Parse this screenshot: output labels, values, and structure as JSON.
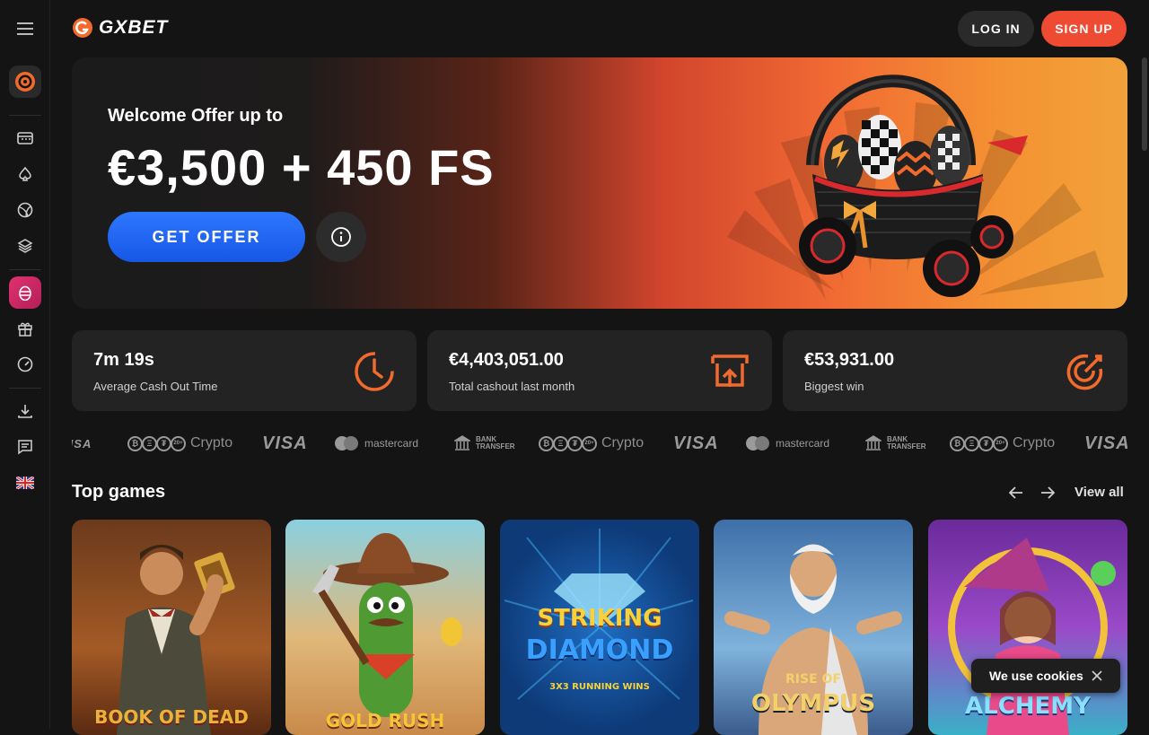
{
  "brand": {
    "name": "GXBET"
  },
  "header": {
    "login_label": "LOG IN",
    "signup_label": "SIGN UP"
  },
  "hero": {
    "subtitle": "Welcome Offer up to",
    "title": "€3,500 + 450 FS",
    "cta_label": "GET OFFER"
  },
  "stats": [
    {
      "value": "7m 19s",
      "label": "Average Cash Out Time",
      "icon": "timer-icon"
    },
    {
      "value": "€4,403,051.00",
      "label": "Total cashout last month",
      "icon": "cashout-icon"
    },
    {
      "value": "€53,931.00",
      "label": "Biggest win",
      "icon": "target-icon"
    }
  ],
  "payments": {
    "crypto_label": "Crypto",
    "visa_label": "VISA",
    "mastercard_label": "mastercard",
    "bank_line1": "BANK",
    "bank_line2": "TRANSFER",
    "coin_more": "20+"
  },
  "top_games": {
    "title": "Top games",
    "view_all_label": "View all",
    "games": [
      {
        "title_line1": "BOOK OF DEAD",
        "title_line2": ""
      },
      {
        "title_line1": "GOLD RUSH",
        "title_line2": ""
      },
      {
        "title_line1": "STRIKING",
        "title_line2": "DIAMOND",
        "tagline": "3X3 RUNNING WINS"
      },
      {
        "title_line1": "RISE OF",
        "title_line2": "OLYMPUS"
      },
      {
        "title_line1": "ALCHEMY",
        "title_line2": ""
      }
    ]
  },
  "cookie": {
    "text": "We use cookies"
  },
  "colors": {
    "accent": "#ef4a32",
    "cta_blue": "#2266f5",
    "stat_icon": "#f26b2c"
  }
}
